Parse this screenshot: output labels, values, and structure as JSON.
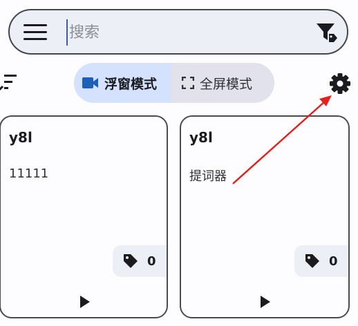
{
  "search": {
    "placeholder": "搜索"
  },
  "modes": {
    "floating_label": "浮窗模式",
    "fullscreen_label": "全屏模式",
    "active": "floating"
  },
  "notes": [
    {
      "title": "y8l",
      "content": "11111",
      "tag_count": "0"
    },
    {
      "title": "y8l",
      "content": "提词器",
      "tag_count": "0"
    }
  ],
  "icons": {
    "menu": "menu-icon",
    "filter": "filter-tag-icon",
    "sort": "sort-icon",
    "floating": "videocam-icon",
    "fullscreen": "fullscreen-icon",
    "settings": "gear-icon",
    "tag": "tag-icon",
    "play": "play-icon"
  },
  "colors": {
    "accent": "#d4e2ff",
    "toggle_bg": "#e1e2ec",
    "search_bg": "#eceff6",
    "annotation": "#e3201b",
    "video_icon": "#1e5fb8"
  }
}
